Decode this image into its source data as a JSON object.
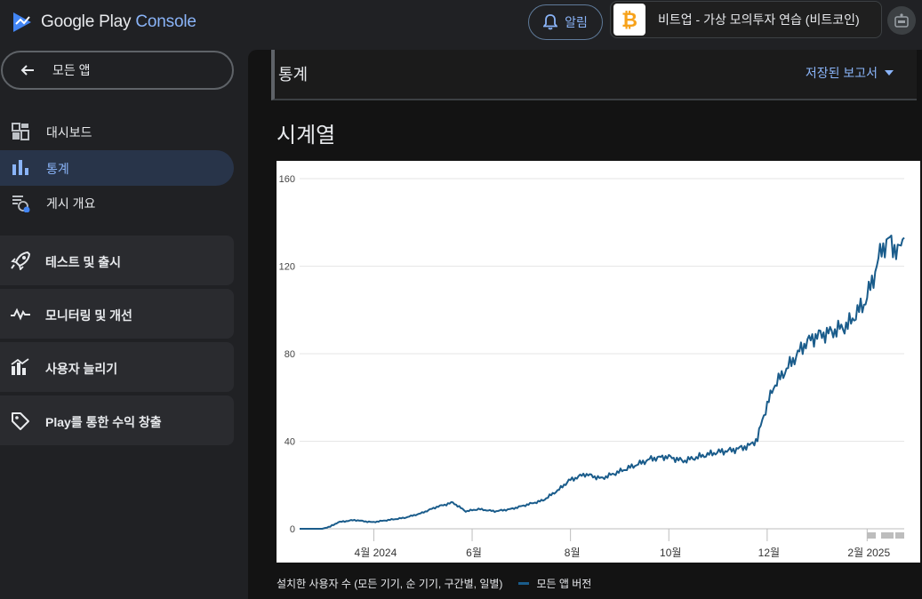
{
  "header": {
    "logo_google_play": "Google Play",
    "logo_console": "Console",
    "notifications_label": "알림",
    "app_name": "비트업 - 가상 모의투자 연습 (비트코인)"
  },
  "sidebar": {
    "back_label": "모든 앱",
    "items": [
      {
        "label": "대시보드"
      },
      {
        "label": "통계"
      },
      {
        "label": "게시 개요"
      }
    ],
    "sections": [
      {
        "label": "테스트 및 출시"
      },
      {
        "label": "모니터링 및 개선"
      },
      {
        "label": "사용자 늘리기"
      },
      {
        "label": "Play를 통한 수익 창출"
      }
    ]
  },
  "main": {
    "page_title": "통계",
    "saved_reports_label": "저장된 보고서",
    "section_title": "시계열"
  },
  "chart_data": {
    "type": "line",
    "title": "",
    "ylim": [
      0,
      160
    ],
    "yticks": [
      "0",
      "40",
      "80",
      "120",
      "160"
    ],
    "xticks": [
      "4월 2024",
      "6월",
      "8월",
      "10월",
      "12월",
      "2월 2025"
    ],
    "grid": true,
    "legend_position": "bottom-left",
    "metric_label": "설치한 사용자 수 (모든 기기, 순 기기, 구간별, 일별)",
    "series": [
      {
        "name": "모든 앱 버전",
        "color": "#1a5c8b",
        "x": [
          "2024-02-15",
          "2024-02-29",
          "2024-03-05",
          "2024-03-10",
          "2024-03-20",
          "2024-03-31",
          "2024-04-10",
          "2024-04-20",
          "2024-04-30",
          "2024-05-10",
          "2024-05-20",
          "2024-05-28",
          "2024-06-05",
          "2024-06-15",
          "2024-06-25",
          "2024-07-05",
          "2024-07-15",
          "2024-07-25",
          "2024-07-31",
          "2024-08-10",
          "2024-08-20",
          "2024-08-31",
          "2024-09-10",
          "2024-09-20",
          "2024-09-30",
          "2024-10-10",
          "2024-10-20",
          "2024-10-31",
          "2024-11-10",
          "2024-11-20",
          "2024-11-25",
          "2024-11-28",
          "2024-12-05",
          "2024-12-15",
          "2024-12-25",
          "2024-12-31",
          "2025-01-10",
          "2025-01-20",
          "2025-01-31",
          "2025-02-05",
          "2025-02-10",
          "2025-02-15",
          "2025-02-20",
          "2025-02-24"
        ],
        "values": [
          0,
          0,
          1,
          3,
          4,
          3,
          4,
          5,
          7,
          10,
          12,
          8,
          9,
          8,
          9,
          11,
          13,
          18,
          22,
          25,
          23,
          26,
          29,
          32,
          33,
          31,
          33,
          35,
          36,
          38,
          41,
          50,
          65,
          75,
          85,
          88,
          90,
          93,
          104,
          115,
          128,
          132,
          126,
          133
        ]
      }
    ]
  }
}
